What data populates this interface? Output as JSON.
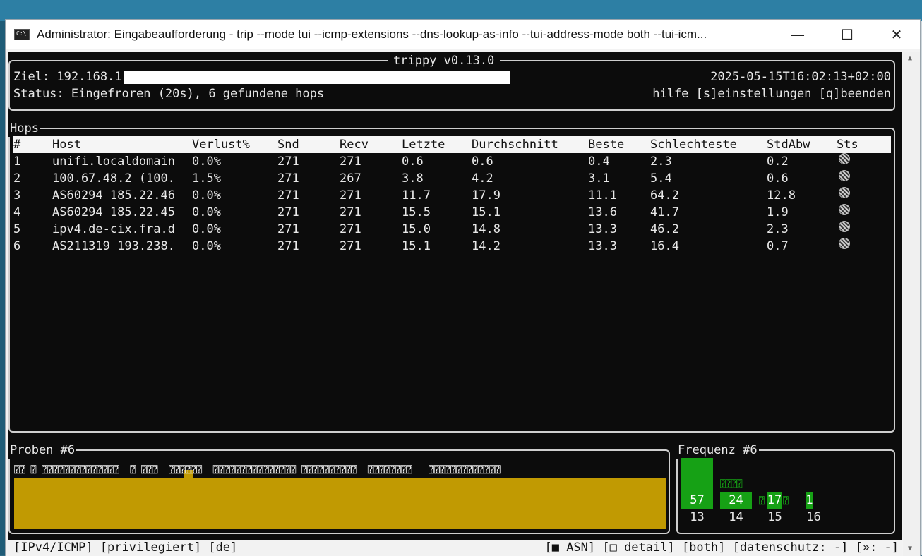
{
  "window": {
    "title": "Administrator: Eingabeaufforderung - trip  --mode tui --icmp-extensions --dns-lookup-as-info --tui-address-mode both --tui-icm...",
    "minimize": "—",
    "maximize": "☐",
    "close": "✕"
  },
  "header": {
    "app_title": "trippy v0.13.0",
    "target_label": "Ziel: 192.168.1",
    "timestamp": "2025-05-15T16:02:13+02:00",
    "status": "Status: Eingefroren (20s), 6 gefundene hops",
    "help": "hilfe [s]einstellungen [q]beenden"
  },
  "hops": {
    "title": "Hops",
    "columns": [
      "#",
      "Host",
      "Verlust%",
      "Snd",
      "Recv",
      "Letzte",
      "Durchschnitt",
      "Beste",
      "Schlechteste",
      "StdAbw",
      "Sts"
    ],
    "rows": [
      [
        "1",
        "unifi.localdomain",
        "0.0%",
        "271",
        "271",
        "0.6",
        "0.6",
        "0.4",
        "2.3",
        "0.2"
      ],
      [
        "2",
        "100.67.48.2 (100.",
        "1.5%",
        "271",
        "267",
        "3.8",
        "4.2",
        "3.1",
        "5.4",
        "0.6"
      ],
      [
        "3",
        "AS60294 185.22.46",
        "0.0%",
        "271",
        "271",
        "11.7",
        "17.9",
        "11.1",
        "64.2",
        "12.8"
      ],
      [
        "4",
        "AS60294 185.22.45",
        "0.0%",
        "271",
        "271",
        "15.5",
        "15.1",
        "13.6",
        "41.7",
        "1.9"
      ],
      [
        "5",
        "ipv4.de-cix.fra.d",
        "0.0%",
        "271",
        "271",
        "15.0",
        "14.8",
        "13.3",
        "46.2",
        "2.3"
      ],
      [
        "6",
        "AS211319 193.238.",
        "0.0%",
        "271",
        "271",
        "15.1",
        "14.2",
        "13.3",
        "16.4",
        "0.7"
      ]
    ]
  },
  "samples": {
    "title": "Proben #6",
    "glyphs": "⍰⍰ ⍰ ⍰⍰⍰⍰⍰⍰⍰⍰⍰⍰⍰⍰⍰⍰  ⍰ ⍰⍰⍰  ⍰⍰⍰⍰⍰⍰  ⍰⍰⍰⍰⍰⍰⍰⍰⍰⍰⍰⍰⍰⍰⍰ ⍰⍰⍰⍰⍰⍰⍰⍰⍰⍰  ⍰⍰⍰⍰⍰⍰⍰⍰   ⍰⍰⍰⍰⍰⍰⍰⍰⍰⍰⍰⍰⍰",
    "color": "#c19a02"
  },
  "frequency": {
    "title": "Frequenz #6",
    "color": "#16a115",
    "bars": [
      {
        "label": "13",
        "value": "57"
      },
      {
        "label": "14",
        "value": "24"
      },
      {
        "label": "15",
        "value": "17"
      },
      {
        "label": "16",
        "value": "1"
      }
    ],
    "glyph_above_14": "⍰⍰⍰⍰",
    "glyph_15_left": "⍰",
    "glyph_15_right": "⍰"
  },
  "footer": {
    "left": "[IPv4/ICMP] [privilegiert] [de]",
    "right": "[■ ASN] [□ detail] [both] [datenschutz: -] [»: -]"
  }
}
